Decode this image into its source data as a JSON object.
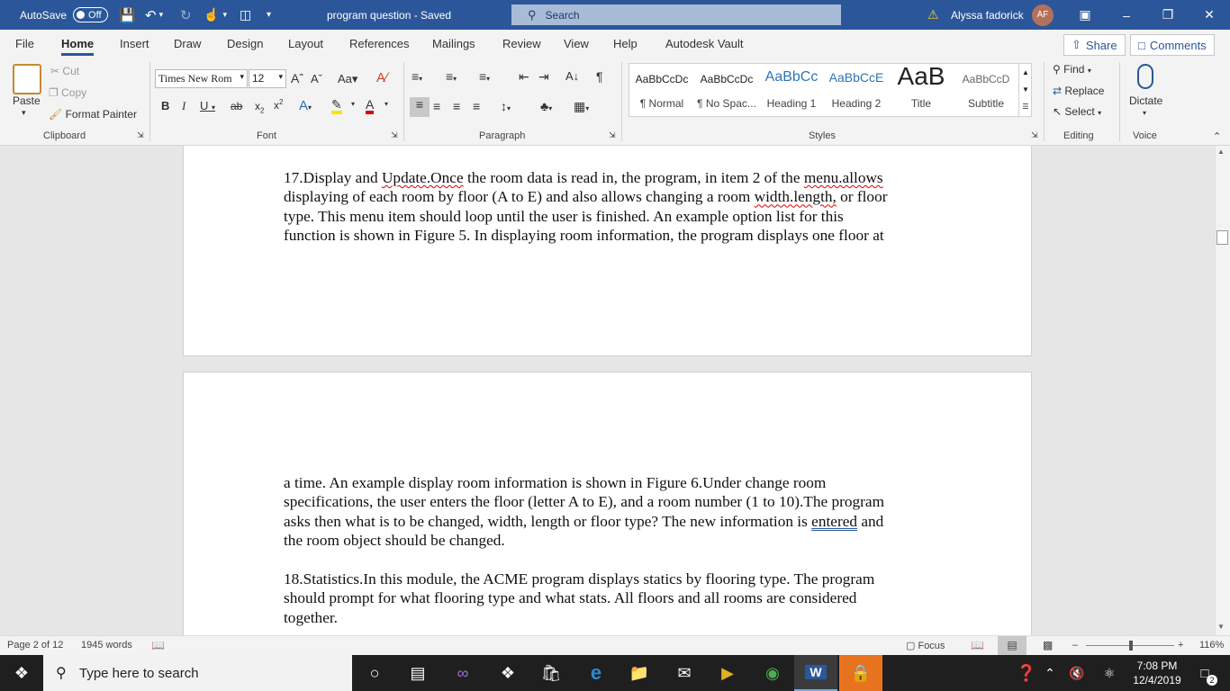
{
  "titlebar": {
    "autosave_label": "AutoSave",
    "autosave_state": "Off",
    "doc_title": "program question - Saved",
    "search_placeholder": "Search",
    "user_name": "Alyssa fadorick",
    "user_initials": "AF"
  },
  "menu": {
    "items": [
      "File",
      "Home",
      "Insert",
      "Draw",
      "Design",
      "Layout",
      "References",
      "Mailings",
      "Review",
      "View",
      "Help",
      "Autodesk Vault"
    ],
    "active": "Home",
    "share_label": "Share",
    "comments_label": "Comments"
  },
  "ribbon": {
    "clipboard": {
      "paste": "Paste",
      "cut": "Cut",
      "copy": "Copy",
      "format_painter": "Format Painter",
      "group": "Clipboard"
    },
    "font": {
      "family": "Times New Rom",
      "size": "12",
      "group": "Font"
    },
    "paragraph": {
      "group": "Paragraph"
    },
    "styles": {
      "group": "Styles",
      "items": [
        {
          "preview": "AaBbCcDc",
          "name": "¶ Normal"
        },
        {
          "preview": "AaBbCcDc",
          "name": "¶ No Spac..."
        },
        {
          "preview": "AaBbCc",
          "name": "Heading 1"
        },
        {
          "preview": "AaBbCcE",
          "name": "Heading 2"
        },
        {
          "preview": "AaB",
          "name": "Title"
        },
        {
          "preview": "AaBbCcD",
          "name": "Subtitle"
        }
      ]
    },
    "editing": {
      "find": "Find",
      "replace": "Replace",
      "select": "Select",
      "group": "Editing"
    },
    "voice": {
      "dictate": "Dictate",
      "group": "Voice"
    }
  },
  "document": {
    "page1_lines": [
      "the room data is read in, the program, in item 2 of the",
      "displaying of each room by floor (A to E) and also allows changing a room ",
      "type. This menu item should loop until the user is finished. An example option list for this",
      "function is shown in Figure 5. In displaying room information, the program displays one floor at"
    ],
    "p1_prefix": "17.Display and ",
    "p1_word1": "Update.Once",
    "p1_word2": "menu.allows",
    "p1_word3": "width.length,",
    "p1_tail": " or floor",
    "page2_lines": [
      "a time. An example display room information is shown in Figure 6.Under change room",
      "specifications, the user enters the floor (letter A to E), and a room number (1 to 10).The program",
      "asks then what is to be changed, width, length or floor type? The new information is ",
      "the room object should be changed."
    ],
    "p2_word": "entered",
    "p2_and": " and",
    "para18_lines": [
      "18.Statistics.In this module, the ACME program displays statics by flooring type. The program",
      "should prompt for what flooring type and what stats. All floors and all rooms are considered",
      "together."
    ]
  },
  "status": {
    "page": "Page 2 of 12",
    "words": "1945 words",
    "focus": "Focus",
    "zoom": "116%"
  },
  "taskbar": {
    "search_placeholder": "Type here to search",
    "time": "7:08 PM",
    "date": "12/4/2019",
    "notifications": "2"
  },
  "colors": {
    "title_blue": "#2b579a",
    "ribbon_bg": "#f3f3f3",
    "taskbar": "#1f1f1f"
  }
}
